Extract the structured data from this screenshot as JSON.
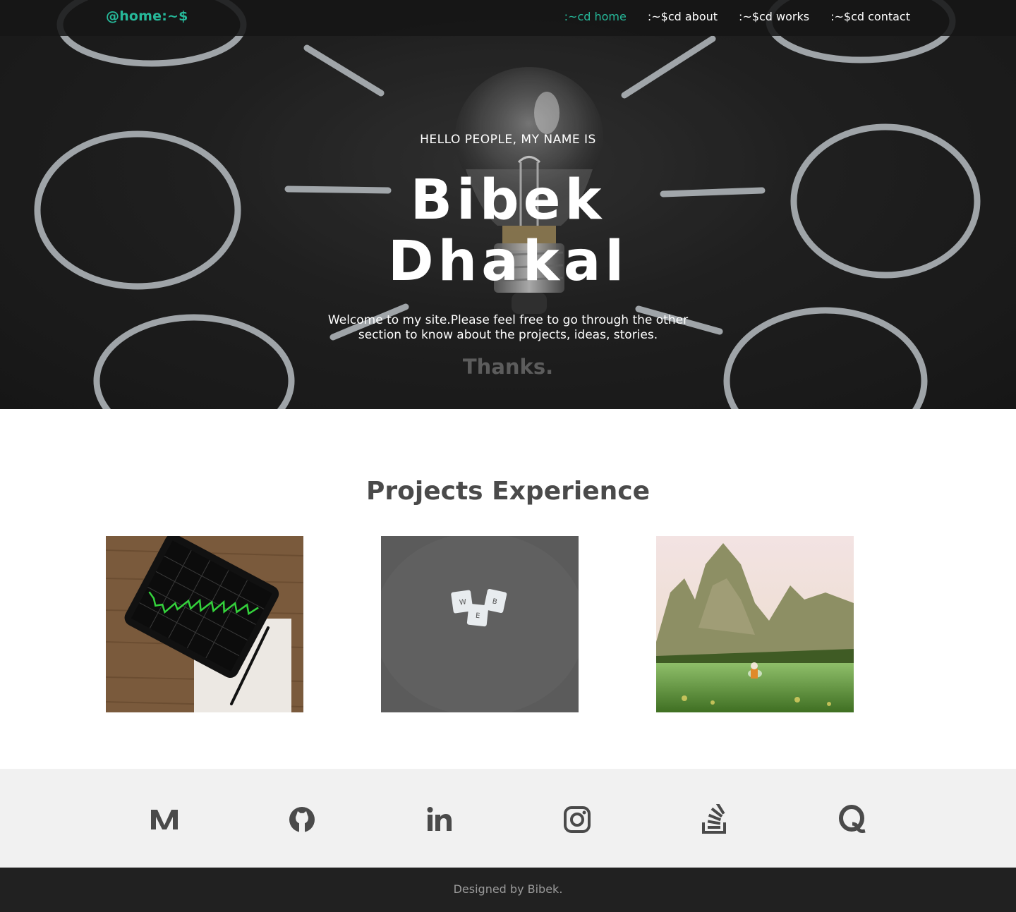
{
  "nav": {
    "brand": "@home:~$",
    "links": [
      {
        "label": ":~cd home",
        "active": true
      },
      {
        "label": ":~$cd about",
        "active": false
      },
      {
        "label": ":~$cd works",
        "active": false
      },
      {
        "label": ":~$cd contact",
        "active": false
      }
    ]
  },
  "hero": {
    "greeting": "HELLO PEOPLE, MY NAME IS",
    "name_first": "Bibek",
    "name_last": "Dhakal",
    "welcome": "Welcome to my site.Please feel free to go through the other section to know about the projects, ideas, stories.",
    "thanks": "Thanks."
  },
  "projects": {
    "title": "Projects Experience",
    "items": [
      {
        "image": "tablet-stock-chart-image"
      },
      {
        "image": "web-letter-tiles-image"
      },
      {
        "image": "mountain-rice-field-image"
      }
    ]
  },
  "social": {
    "icons": [
      "medium-icon",
      "github-icon",
      "linkedin-icon",
      "instagram-icon",
      "stackoverflow-icon",
      "quora-icon"
    ]
  },
  "footer": {
    "text": "Designed by Bibek."
  },
  "colors": {
    "accent": "#26b99a",
    "nav_bg": "#161616",
    "social_bg": "#f1f1f1",
    "footer_bg": "#212121",
    "heading": "#4a4a4a"
  }
}
